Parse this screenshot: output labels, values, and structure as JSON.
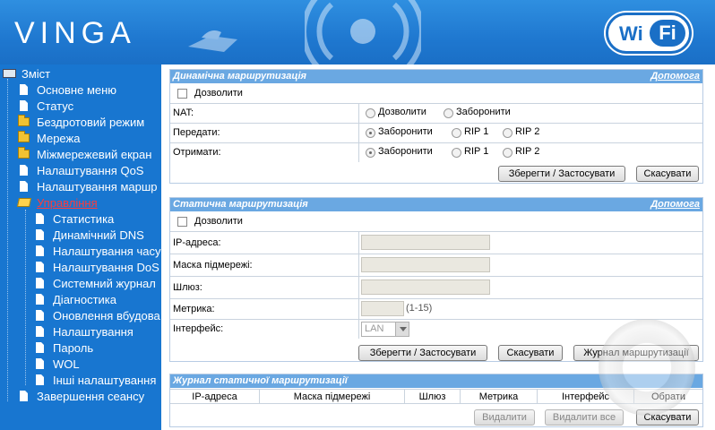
{
  "header": {
    "logo": "VINGA",
    "badge_left": "Wi",
    "badge_right": "Fi"
  },
  "sidebar": {
    "root": "Зміст",
    "items": [
      {
        "label": "Основне меню",
        "icon": "doc-icon"
      },
      {
        "label": "Статус",
        "icon": "doc-icon"
      },
      {
        "label": "Бездротовий режим",
        "icon": "folder-icon"
      },
      {
        "label": "Мережа",
        "icon": "folder-icon"
      },
      {
        "label": "Міжмережевий екран",
        "icon": "folder-icon"
      },
      {
        "label": "Налаштування QoS",
        "icon": "doc-icon"
      },
      {
        "label": "Налаштування маршр",
        "icon": "doc-icon"
      },
      {
        "label": "Управління",
        "icon": "folder-open-icon"
      }
    ],
    "sub_items": [
      "Статистика",
      "Динамічний DNS",
      "Налаштування часу",
      "Налаштування DoS",
      "Системний журнал",
      "Діагностика",
      "Оновлення вбудова",
      "Налаштування",
      "Пароль",
      "WOL",
      "Інші налаштування"
    ],
    "logout": "Завершення сеансу"
  },
  "dynamic": {
    "title": "Динамічна маршрутизація",
    "help": "Допомога",
    "enable": "Дозволити",
    "nat_label": "NAT:",
    "nat_opt1": "Дозволити",
    "nat_opt2": "Заборонити",
    "tx_label": "Передати:",
    "rx_label": "Отримати:",
    "opt_forbid": "Заборонити",
    "opt_rip1": "RIP 1",
    "opt_rip2": "RIP 2",
    "save": "Зберегти / Застосувати",
    "cancel": "Скасувати"
  },
  "static": {
    "title": "Статична маршрутизація",
    "help": "Допомога",
    "enable": "Дозволити",
    "ip_label": "IP-адреса:",
    "mask_label": "Маска підмережі:",
    "gw_label": "Шлюз:",
    "metric_label": "Метрика:",
    "metric_hint": "(1-15)",
    "iface_label": "Інтерфейс:",
    "iface_value": "LAN",
    "save": "Зберегти / Застосувати",
    "cancel": "Скасувати",
    "log": "Журнал маршрутизації"
  },
  "log": {
    "title": "Журнал статичної маршрутизації",
    "columns": [
      "IP-адреса",
      "Маска підмережі",
      "Шлюз",
      "Метрика",
      "Інтерфейс",
      "Обрати"
    ],
    "delete": "Видалити",
    "delete_all": "Видалити все",
    "cancel": "Скасувати"
  }
}
